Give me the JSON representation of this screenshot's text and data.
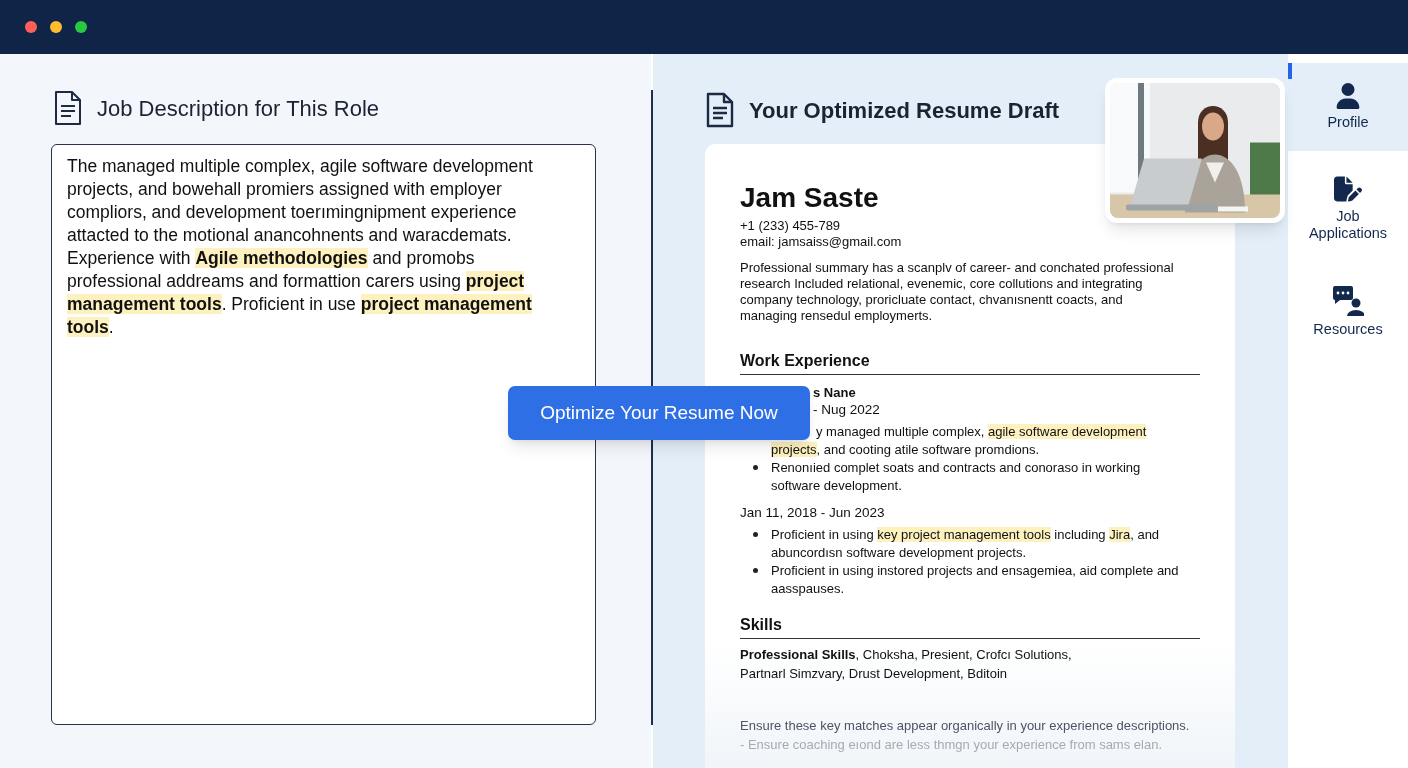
{
  "window": {
    "controls": [
      {
        "color": "#ff5f57"
      },
      {
        "color": "#febc2e"
      },
      {
        "color": "#28c840"
      }
    ]
  },
  "job_description": {
    "title": "Job Description for This Role",
    "text": [
      {
        "text": "The managed multiple complex, agile software development projects, and bowehall promiers assigned with employer compliors, and development toerımingnipment experience attacted to the motional anancohnents and waracdemats. Experience with ",
        "highlight": false
      },
      {
        "text": "Agile methodologies",
        "highlight": true
      },
      {
        "text": " and promobs professional addreams and formattion carers using ",
        "highlight": false
      },
      {
        "text": "project management tools",
        "highlight": true
      },
      {
        "text": ". Proficient in use ",
        "highlight": false
      },
      {
        "text": "project management tools",
        "highlight": true
      },
      {
        "text": ".",
        "highlight": false
      }
    ]
  },
  "optimize_button": {
    "label": "Optimize Your Resume Now"
  },
  "resume": {
    "title": "Your Optimized Resume Draft",
    "name": "Jam Saste",
    "phone": "+1 (233) 455-789",
    "email": "email: jamsaiss@gmail.com",
    "summary": "Professional summary has a scanplv of career- and conchated professional research Included relational, evenemic, core collutions and integrating company technology, proricluate contact, chvanısnentt coacts, and managing rensedul employmerts.",
    "work_heading": "Work Experience",
    "jobs": [
      {
        "kind": "partial",
        "title": "s Nane",
        "dates": "- Nug 2022",
        "bullets": [
          {
            "kind": "fragment",
            "segments": [
              {
                "text": "y managed multiple complex, ",
                "highlight": false
              },
              {
                "text": "agile software development projects",
                "highlight": true
              },
              {
                "text": ", and cooting atile software promdions.",
                "highlight": false
              }
            ]
          },
          {
            "kind": "bullet",
            "segments": [
              {
                "text": "Renonıied complet soats and contracts and conoraso in working software development.",
                "highlight": false
              }
            ]
          }
        ]
      },
      {
        "kind": "full",
        "dates": "Jan 11, 2018 - Jun 2023",
        "bullets": [
          {
            "kind": "bullet",
            "segments": [
              {
                "text": "Proficient in using ",
                "highlight": false
              },
              {
                "text": "key project management tools",
                "highlight": true
              },
              {
                "text": " including ",
                "highlight": false
              },
              {
                "text": "Jira",
                "highlight": true
              },
              {
                "text": ", and abuncordısn software development projects.",
                "highlight": false
              }
            ]
          },
          {
            "kind": "bullet",
            "segments": [
              {
                "text": "Proficient in using instored projects and ensagemiea, aid complete and aasspauses.",
                "highlight": false
              }
            ]
          }
        ]
      }
    ],
    "skills_heading": "Skills",
    "skills_lines": [
      [
        {
          "text": "Professional Skills",
          "bold": true
        },
        {
          "text": ", Choksha, Presient, Crofcı Solutions,",
          "bold": false
        }
      ],
      [
        {
          "text": "Partnarl Simzvary, Drust Development, Bditoin",
          "bold": false
        }
      ]
    ],
    "notes": [
      "Ensure these key matches appear organically in your experience descriptions.",
      "- Ensure coaching eıond are less thmgn your experience from sams elan."
    ]
  },
  "sidebar": {
    "items": [
      {
        "kind": "profile",
        "label": "Profile",
        "selected": true
      },
      {
        "kind": "applications",
        "label": "Job Applications",
        "selected": false
      },
      {
        "kind": "resources",
        "label": "Resources",
        "selected": false
      }
    ]
  }
}
